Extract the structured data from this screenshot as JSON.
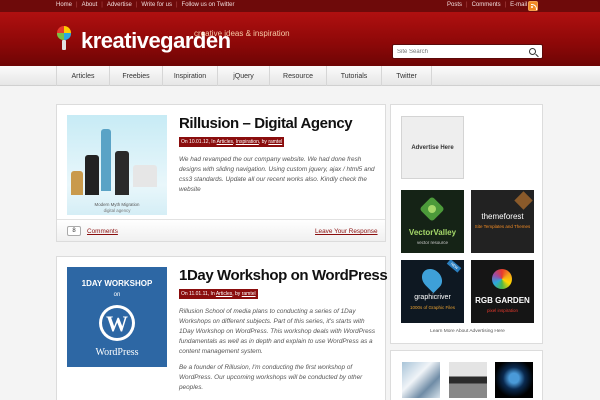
{
  "topbar": {
    "left_links": [
      "Home",
      "About",
      "Advertise",
      "Write for us",
      "Follow us on Twitter"
    ],
    "right_links": [
      "Posts",
      "Comments",
      "E-mail"
    ],
    "rss_icon": "rss-icon"
  },
  "header": {
    "logo_text": "kreativegarden",
    "tagline": "creative ideas & inspiration",
    "search_placeholder": "Site Search"
  },
  "nav": {
    "items": [
      {
        "label": "Articles"
      },
      {
        "label": "Freebies"
      },
      {
        "label": "Inspiration"
      },
      {
        "label": "jQuery"
      },
      {
        "label": "Resource"
      },
      {
        "label": "Tutorials"
      },
      {
        "label": "Twitter"
      }
    ]
  },
  "posts": [
    {
      "title": "Rillusion – Digital Agency",
      "meta_prefix": "On 10.01.12, In ",
      "categories": [
        "Articles",
        "Inspiration"
      ],
      "meta_by": ", by ",
      "author": "ramtel",
      "excerpt": [
        "We had revamped the our company website. We had done fresh designs with sliding navigation. Using custom jquery, ajax / html5 and css3 standards. Update all our recent works also. Kindly check the website"
      ],
      "comment_count": "8",
      "comments_label": "Comments",
      "respond_label": "Leave Your Response",
      "thumb_caption": "Modern Myth Migration",
      "thumb_caption2": "digital agency"
    },
    {
      "title": "1Day Workshop on WordPress",
      "meta_prefix": "On 11.01.11, In ",
      "categories": [
        "Articles"
      ],
      "meta_by": ", by ",
      "author": "ramtel",
      "excerpt": [
        "Rillusion School of media plans to conducting a series of 1Day Workshops on different subjects. Part of this series, it's starts with 1Day Workshop on WordPress. This workshop deals with WordPress fundamentals as well as in depth and explain to use WordPress as a content management system.",
        "Be a founder of Rillusion, I'm conducting the first workshop of WordPress. Our upcoming workshops will be conducted by other peoples."
      ],
      "thumb_title": "1DAY WORKSHOP",
      "thumb_on": "on",
      "thumb_brand": "WordPress"
    }
  ],
  "sidebar": {
    "advertise_label": "Advertise Here",
    "ads": [
      {
        "name": "VectorValley",
        "sub": "vector resource"
      },
      {
        "name": "themeforest",
        "sub": "Site Templates and Themes"
      },
      {
        "name": "graphicriver",
        "sub": "1000s of Graphic Files",
        "badge": "NEW"
      },
      {
        "name": "RGB GARDEN",
        "sub": "pixel inspiration"
      }
    ],
    "note": "Learn More About Advertising Here"
  }
}
